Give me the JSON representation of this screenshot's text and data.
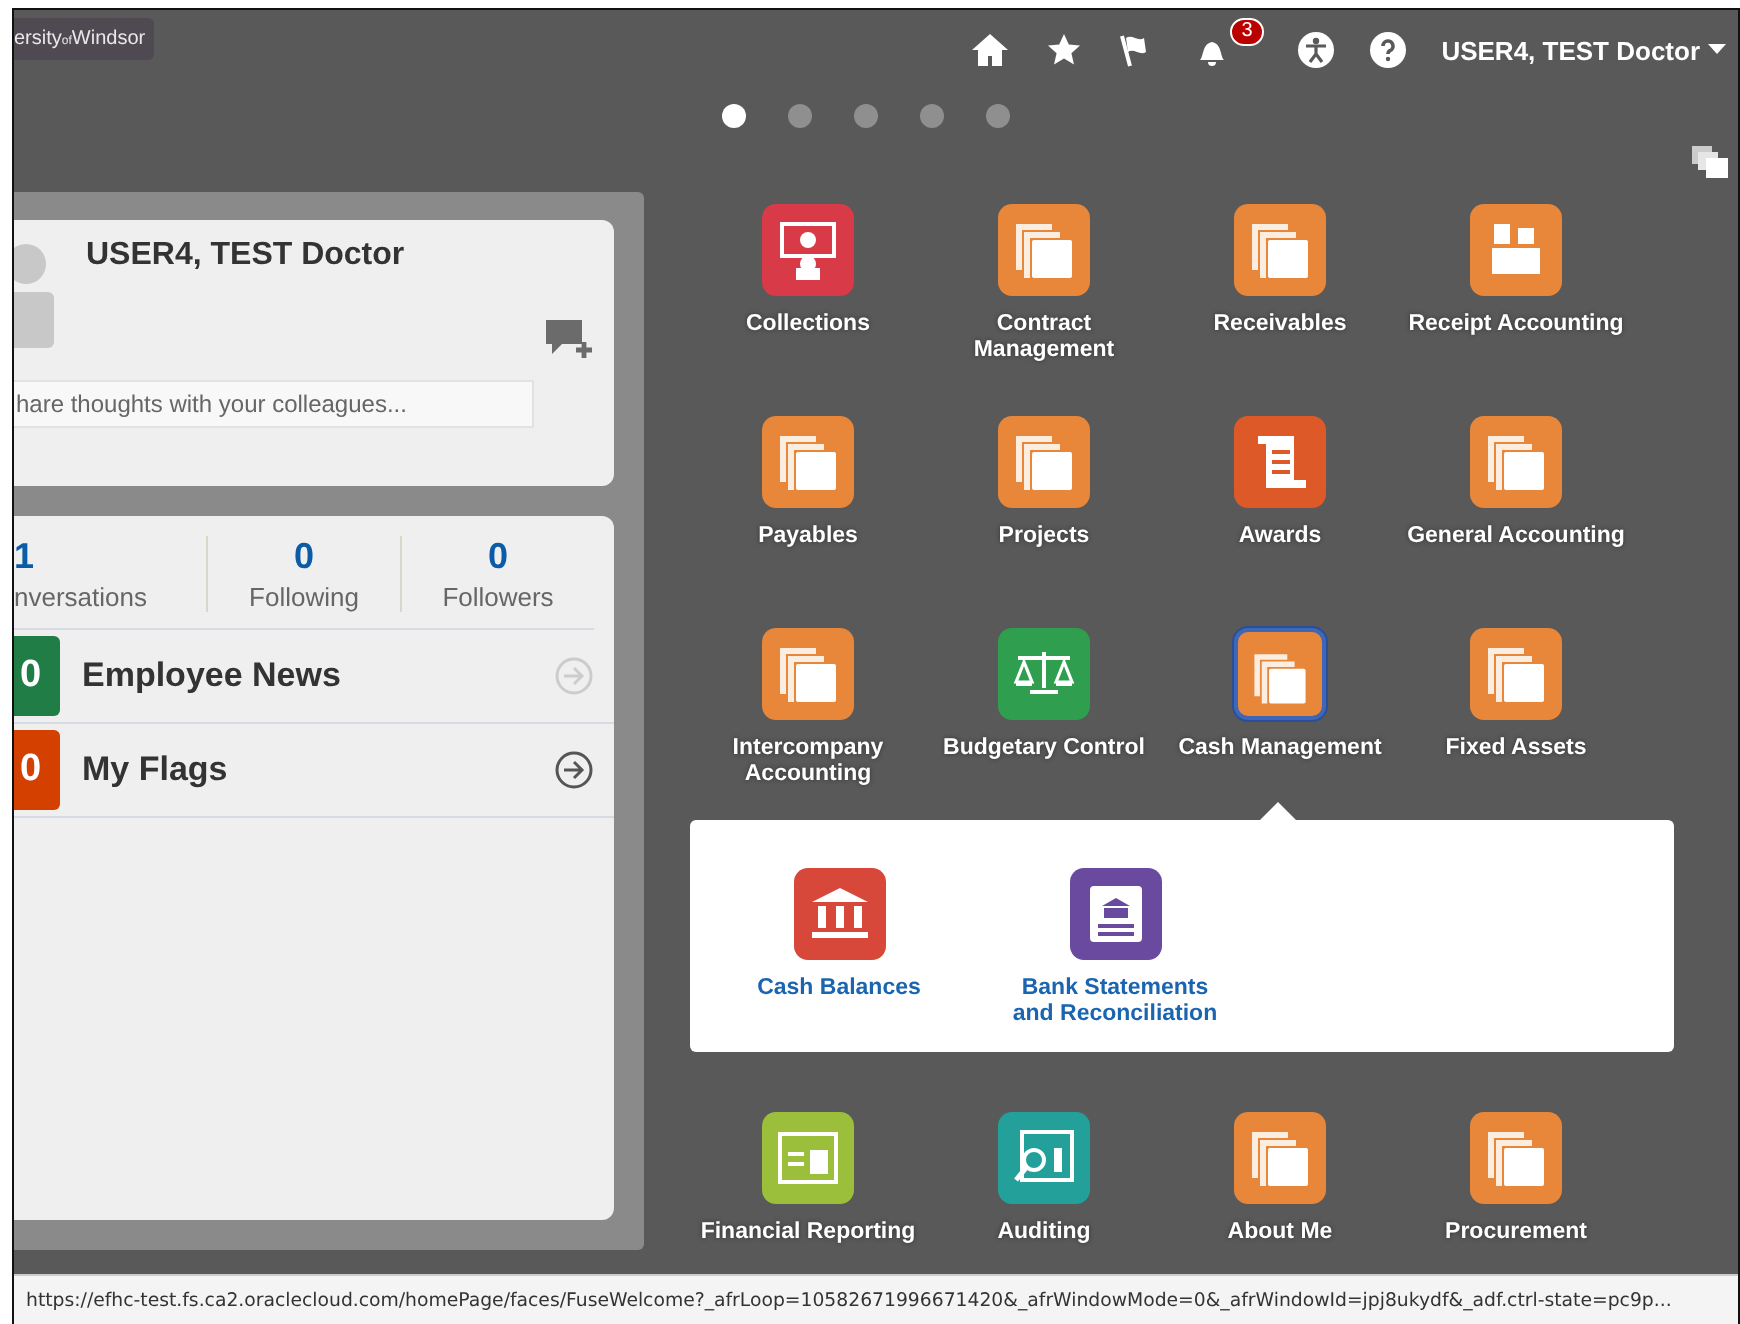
{
  "header": {
    "logo": "ersity$_{of}$Windsor",
    "notification_count": "3",
    "user_menu": "USER4, TEST Doctor"
  },
  "page_dots": [
    {
      "selected": true
    },
    {
      "selected": false
    },
    {
      "selected": false
    },
    {
      "selected": false
    },
    {
      "selected": false
    }
  ],
  "profile_card": {
    "name": "USER4, TEST Doctor",
    "share_field": {
      "placeholder": "hare thoughts with your colleagues..."
    }
  },
  "stats": [
    {
      "value": "1",
      "label": "nversations"
    },
    {
      "value": "0",
      "label": "Following"
    },
    {
      "value": "0",
      "label": "Followers"
    }
  ],
  "lists": [
    {
      "count": "0",
      "label": "Employee News",
      "color": "#1f7d45",
      "disabled": true
    },
    {
      "count": "0",
      "label": "My Flags",
      "color": "#d34000",
      "disabled": false
    }
  ],
  "tiles": [
    {
      "label": "Collections",
      "kind": "collections",
      "selected": false
    },
    {
      "label": "Contract Management",
      "kind": "pages",
      "selected": false
    },
    {
      "label": "Receivables",
      "kind": "pages",
      "selected": false
    },
    {
      "label": "Receipt Accounting",
      "kind": "boxes",
      "selected": false
    },
    {
      "label": "Payables",
      "kind": "pages",
      "selected": false
    },
    {
      "label": "Projects",
      "kind": "pages",
      "selected": false
    },
    {
      "label": "Awards",
      "kind": "scroll",
      "selected": false
    },
    {
      "label": "General Accounting",
      "kind": "pages",
      "selected": false
    },
    {
      "label": "Intercompany Accounting",
      "kind": "pages",
      "selected": false
    },
    {
      "label": "Budgetary Control",
      "kind": "scales",
      "selected": false
    },
    {
      "label": "Cash Management",
      "kind": "pages",
      "selected": true
    },
    {
      "label": "Fixed Assets",
      "kind": "pages",
      "selected": false
    }
  ],
  "submenu": [
    {
      "label": "Cash Balances",
      "kind": "bank"
    },
    {
      "label": "Bank Statements and Reconciliation",
      "kind": "statement"
    }
  ],
  "tiles_below": [
    {
      "label": "Financial Reporting",
      "kind": "report",
      "selected": false
    },
    {
      "label": "Auditing",
      "kind": "audit",
      "selected": false
    },
    {
      "label": "About Me",
      "kind": "pages",
      "selected": false
    },
    {
      "label": "Procurement",
      "kind": "pages",
      "selected": false
    }
  ],
  "status_bar": "https://efhc-test.fs.ca2.oraclecloud.com/homePage/faces/FuseWelcome?_afrLoop=10582671996671420&_afrWindowMode=0&_afrWindowId=jpj8ukydf&_adf.ctrl-state=pc9p..."
}
